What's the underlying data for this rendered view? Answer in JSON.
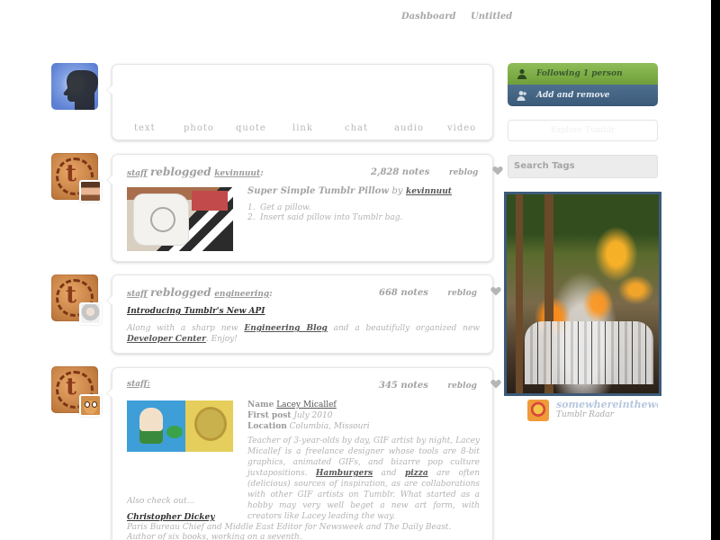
{
  "nav": {
    "dashboard": "Dashboard",
    "untitled": "Untitled"
  },
  "composer": {
    "types": [
      "text",
      "photo",
      "quote",
      "link",
      "chat",
      "audio",
      "video"
    ]
  },
  "posts": [
    {
      "author": "staff",
      "verb": "reblogged",
      "source": "kevinnuut",
      "notes": "2,828 notes",
      "reblog": "reblog",
      "title": "Super Simple Tumblr Pillow",
      "title_by": "by",
      "title_author": "kevinnuut",
      "steps": [
        "Get a pillow.",
        "Insert said pillow into Tumblr bag."
      ]
    },
    {
      "author": "staff",
      "verb": "reblogged",
      "source": "engineering",
      "notes": "668 notes",
      "reblog": "reblog",
      "link": "Introducing Tumblr's New API",
      "body_1": "Along with a sharp new",
      "body_link_1": "Engineering Blog",
      "body_2": "and a beautifully organized new",
      "body_link_2": "Developer Center",
      "body_3": ". Enjoy!"
    },
    {
      "author": "staff:",
      "notes": "345 notes",
      "reblog": "reblog",
      "name_label": "Name",
      "name_value": "Lacey Micallef",
      "first_post_label": "First post",
      "first_post_value": "July 2010",
      "location_label": "Location",
      "location_value": "Columbia, Missouri",
      "bio_1": "Teacher of 3-year-olds by day, GIF artist by night, Lacey Micallef is a freelance designer whose tools are 8-bit graphics, animated GIFs, and bizarre pop culture juxtapositions.",
      "bio_link_1": "Hamburgers",
      "bio_and": "and",
      "bio_link_2": "pizza",
      "bio_2": "are often (delicious) sources of inspiration, as are collaborations with other GIF artists on Tumblr. What started as a hobby may very well beget a new art form, with creators like Lacey leading the way.",
      "also": "Also check out...",
      "also_name": "Christopher Dickey",
      "also_text": "Paris Bureau Chief and Middle East Editor for Newsweek and The Daily Beast. Author of six books, working on a seventh."
    }
  ],
  "sidebar": {
    "following": "Following 1 person",
    "add_remove": "Add and remove",
    "explore": "Explore Tumblr",
    "search_placeholder": "Search Tags",
    "radar_user": "somewhereintheworl",
    "radar_label": "Tumblr Radar"
  },
  "colors": {
    "follow_green": "#7aab45",
    "follow_blue": "#41607f",
    "radar_frame": "#3d5b7a",
    "radar_name": "#b6c7df"
  },
  "icons": {
    "heart": "heart-icon",
    "follow": "person-icon",
    "add": "person-add-icon"
  }
}
